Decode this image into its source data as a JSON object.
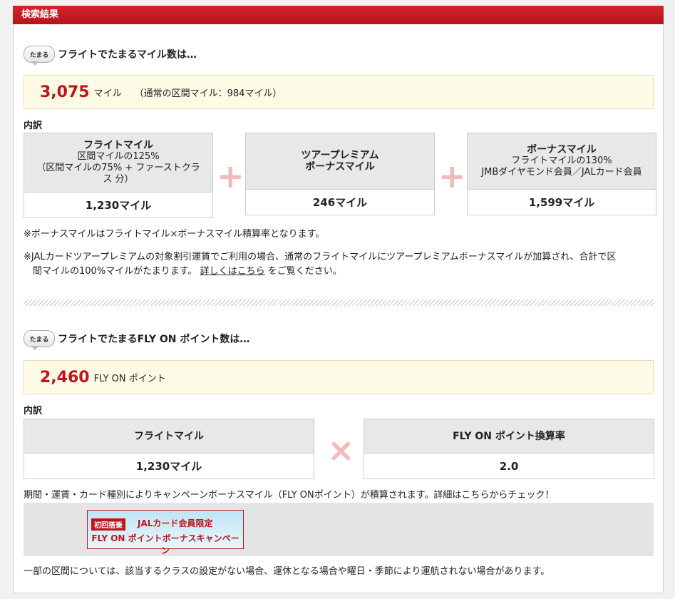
{
  "header": {
    "title": "検索結果"
  },
  "bubble_label": "たまる",
  "miles_section": {
    "title": "フライトでたまるマイル数は…",
    "total_value": "3,075",
    "total_unit": "マイル",
    "normal_note": "（通常の区間マイル：984マイル）",
    "breakdown_label": "内訳",
    "cards": [
      {
        "title": "フライトマイル",
        "line1": "区間マイルの125%",
        "line2": "（区間マイルの75% + ファーストクラ",
        "line3": "ス 分）",
        "value": "1,230マイル"
      },
      {
        "title": "ツアープレミアム",
        "line1": "ボーナスマイル",
        "value": "246マイル"
      },
      {
        "title": "ボーナスマイル",
        "line1": "フライトマイルの130%",
        "line2": "JMBダイヤモンド会員／JALカード会員",
        "value": "1,599マイル"
      }
    ],
    "plus_symbol": "+",
    "note1": "※ボーナスマイルはフライトマイル×ボーナスマイル積算率となります。",
    "note2_line1": "※JALカードツアープレミアムの対象割引運賃でご利用の場合、通常のフライトマイルにツアープレミアムボーナスマイルが加算され、合計で区",
    "note2_line2_pre": "間マイルの100%マイルがたまります。",
    "note2_link": "詳しくはこちら",
    "note2_line2_post": "をご覧ください。"
  },
  "flyon_section": {
    "title": "フライトでたまるFLY ON ポイント数は…",
    "total_value": "2,460",
    "total_unit": "FLY ON ポイント",
    "breakdown_label": "内訳",
    "cards": [
      {
        "title": "フライトマイル",
        "value": "1,230マイル"
      },
      {
        "title": "FLY ON ポイント換算率",
        "value": "2.0"
      }
    ],
    "times_symbol": "×",
    "campaign_note": "期間・運賃・カード種別によりキャンペーンボーナスマイル（FLY ONポイント）が積算されます。詳細はこちらからチェック！",
    "banner": {
      "tag": "初回搭乗",
      "limited": "JALカード会員限定",
      "campaign": "FLY ON ポイントボーナスキャンペーン"
    }
  },
  "footer_note": "一部の区間については、該当するクラスの設定がない場合、運休となる場合や曜日・季節により運航されない場合があります。"
}
